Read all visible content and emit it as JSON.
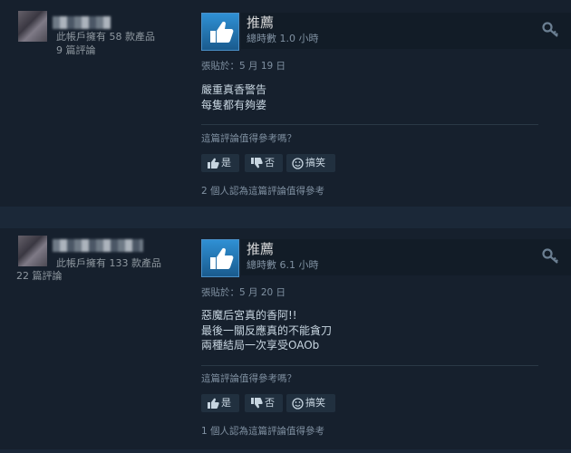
{
  "reviews": [
    {
      "owns_text": "此帳戶擁有 58 款產品",
      "reviews_text": "9 篇評論",
      "recommendation": "推薦",
      "playtime": "總時數 1.0 小時",
      "posted": "張貼於：5 月 19 日",
      "body_lines": [
        "嚴重真香警告",
        "每隻都有夠婆"
      ],
      "helpful_question": "這篇評論值得參考嗎？",
      "buttons": {
        "yes": "是",
        "no": "否",
        "funny": "搞笑"
      },
      "footer": "2 個人認為這篇評論值得參考"
    },
    {
      "owns_text": "此帳戶擁有 133 款產品",
      "reviews_text": "22 篇評論",
      "recommendation": "推薦",
      "playtime": "總時數 6.1 小時",
      "posted": "張貼於：5 月 20 日",
      "body_lines": [
        "惡魔后宮真的香阿!!",
        "最後一關反應真的不能貪刀",
        "兩種結局一次享受OAOb"
      ],
      "helpful_question": "這篇評論值得參考嗎？",
      "buttons": {
        "yes": "是",
        "no": "否",
        "funny": "搞笑"
      },
      "footer": "1 個人認為這篇評論值得參考"
    }
  ],
  "icons": {
    "recommend": "thumbs-up-icon",
    "key": "key-icon",
    "yes": "thumbs-up-icon",
    "no": "thumbs-down-icon",
    "funny": "smiley-icon"
  },
  "colors": {
    "background": "#1b2838",
    "panel": "#16202d",
    "accent_blue": "#2f90d4",
    "text_muted": "#8091a2",
    "text_body": "#c7d5e0"
  }
}
